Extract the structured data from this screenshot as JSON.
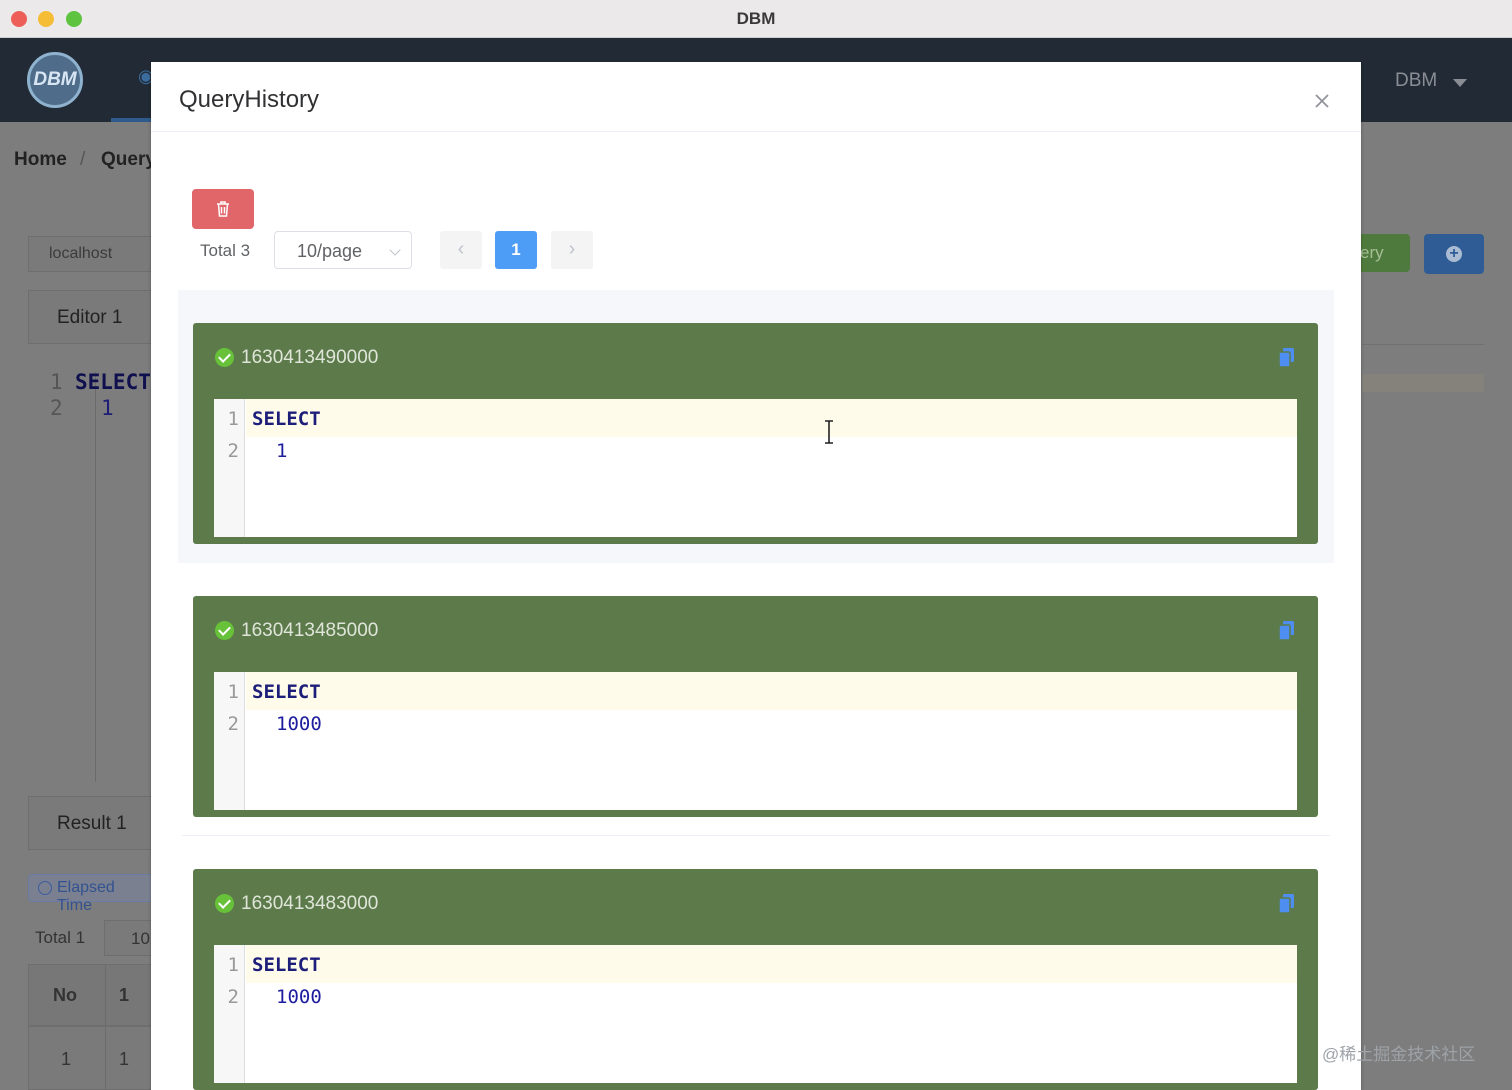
{
  "window": {
    "title": "DBM"
  },
  "app": {
    "logo_text": "DBM",
    "user_menu": "DBM",
    "breadcrumb": {
      "home": "Home",
      "current": "Query"
    },
    "connection": "localhost",
    "editor_tab": "Editor 1",
    "editor_lines": [
      {
        "num": "1",
        "text": "SELECT"
      },
      {
        "num": "2",
        "text": "1"
      }
    ],
    "result_tab": "Result 1",
    "elapsed_label": "Elapsed Time",
    "result_total": "Total 1",
    "result_page_size": "10",
    "table": {
      "headers": [
        "No",
        "1"
      ],
      "rows": [
        [
          "1",
          "1"
        ]
      ]
    },
    "run_button_label": "ery"
  },
  "modal": {
    "title": "QueryHistory",
    "pagination": {
      "total": "Total 3",
      "page_size": "10/page",
      "current_page": "1"
    },
    "items": [
      {
        "timestamp": "1630413490000",
        "status": "success",
        "lines": [
          {
            "num": "1",
            "text": "SELECT"
          },
          {
            "num": "2",
            "text": "1"
          }
        ]
      },
      {
        "timestamp": "1630413485000",
        "status": "success",
        "lines": [
          {
            "num": "1",
            "text": "SELECT"
          },
          {
            "num": "2",
            "text": "1000"
          }
        ]
      },
      {
        "timestamp": "1630413483000",
        "status": "success",
        "lines": [
          {
            "num": "1",
            "text": "SELECT"
          },
          {
            "num": "2",
            "text": "1000"
          }
        ]
      }
    ]
  },
  "watermark": "@稀土掘金技术社区",
  "colors": {
    "card_bg": "#5c7a4a",
    "primary": "#4d9cf6",
    "danger": "#e1666a",
    "success": "#67c23a"
  },
  "icons": {
    "delete": "trash-icon",
    "copy": "copy-icon",
    "close": "close-icon",
    "status": "check-circle-icon"
  }
}
